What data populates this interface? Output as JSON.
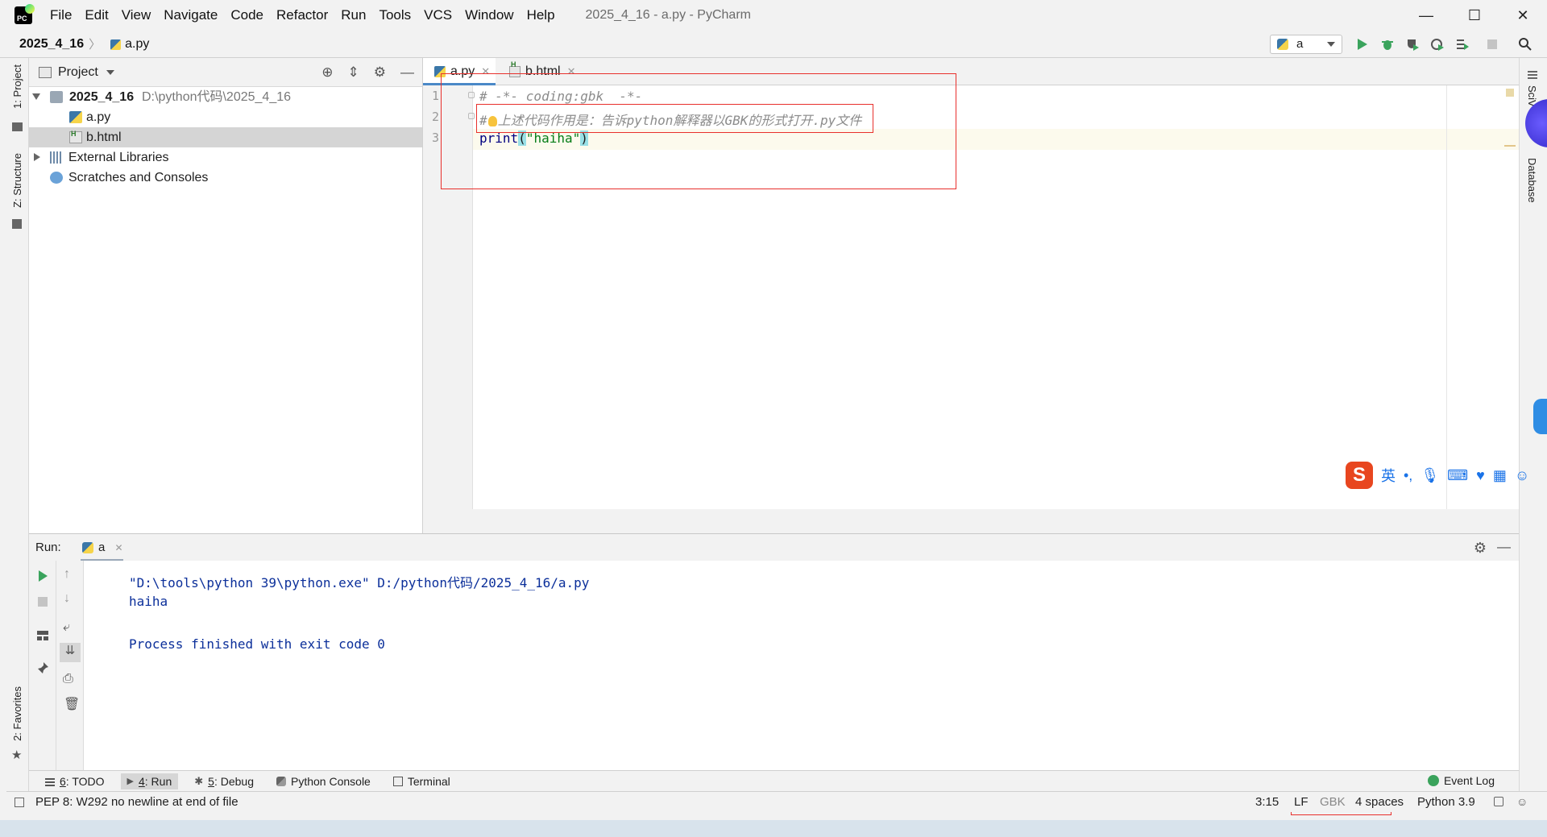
{
  "window": {
    "title": "2025_4_16 - a.py - PyCharm",
    "menu": [
      "File",
      "Edit",
      "View",
      "Navigate",
      "Code",
      "Refactor",
      "Run",
      "Tools",
      "VCS",
      "Window",
      "Help"
    ],
    "controls": {
      "minimize": "—",
      "maximize": "☐",
      "close": "✕"
    }
  },
  "navbar": {
    "project": "2025_4_16",
    "file": "a.py",
    "run_config": "a"
  },
  "left_strip": {
    "project_tab": "1: Project",
    "structure_tab": "Z: Structure",
    "favorites_tab": "2: Favorites"
  },
  "right_strip": {
    "scv_tab": "SciV",
    "database_tab": "Database"
  },
  "project_panel": {
    "title": "Project",
    "tree": [
      {
        "name": "2025_4_16",
        "path": "D:\\python代码\\2025_4_16"
      },
      {
        "name": "a.py"
      },
      {
        "name": "b.html"
      },
      {
        "name": "External Libraries"
      },
      {
        "name": "Scratches and Consoles"
      }
    ]
  },
  "editor": {
    "tabs": [
      "a.py",
      "b.html"
    ],
    "line_numbers": [
      "1",
      "2",
      "3"
    ],
    "lines": {
      "l1": "# -*- coding:gbk  -*-",
      "l2_hash": "#",
      "l2_rest": "上述代码作用是：告诉python解释器以GBK的形式打开.py文件",
      "l3_fn": "print",
      "l3_open": "(",
      "l3_str": "\"haiha\"",
      "l3_close": ")"
    }
  },
  "run_panel": {
    "label": "Run:",
    "tab": "a",
    "output": [
      "\"D:\\tools\\python 39\\python.exe\" D:/python代码/2025_4_16/a.py",
      "haiha",
      "Process finished with exit code 0"
    ]
  },
  "tool_tabs": {
    "todo_num": "6",
    "todo": ": TODO",
    "run_num": "4",
    "run": ": Run",
    "debug_num": "5",
    "debug": ": Debug",
    "python_console": "Python Console",
    "terminal": "Terminal",
    "event_log": "Event Log"
  },
  "status_bar": {
    "message": "PEP 8: W292 no newline at end of file",
    "position": "3:15",
    "line_sep": "LF",
    "encoding": "GBK",
    "indent": "4 spaces",
    "interpreter": "Python 3.9"
  },
  "ime": {
    "logo": "S",
    "lang": "英",
    "punct": "•,"
  },
  "colors": {
    "accent": "#4a88c7",
    "highlight_box": "#e8302c",
    "string": "#067d17",
    "output": "#0b2f9a"
  }
}
